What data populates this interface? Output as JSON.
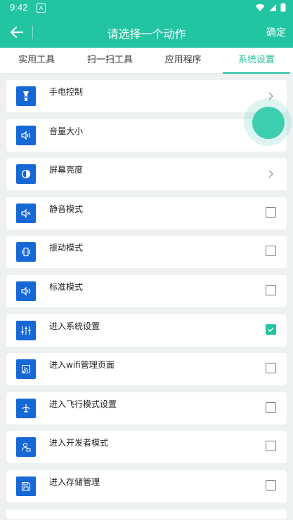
{
  "status_bar": {
    "time": "9:42",
    "notification_glyph": "A"
  },
  "app_bar": {
    "title": "请选择一个动作",
    "confirm_label": "确定"
  },
  "tabs": [
    {
      "label": "实用工具"
    },
    {
      "label": "扫一扫工具"
    },
    {
      "label": "应用程序"
    },
    {
      "label": "系统设置",
      "active": true
    }
  ],
  "items": [
    {
      "label": "手电控制",
      "icon": "flashlight-icon",
      "control": "chevron"
    },
    {
      "label": "音量大小",
      "icon": "volume-icon",
      "control": "chevron"
    },
    {
      "label": "屏幕亮度",
      "icon": "brightness-icon",
      "control": "chevron"
    },
    {
      "label": "静音模式",
      "icon": "mute-icon",
      "control": "checkbox",
      "checked": false
    },
    {
      "label": "振动模式",
      "icon": "vibrate-icon",
      "control": "checkbox",
      "checked": false
    },
    {
      "label": "标准模式",
      "icon": "speaker-icon",
      "control": "checkbox",
      "checked": false
    },
    {
      "label": "进入系统设置",
      "icon": "settings-sliders-icon",
      "control": "checkbox",
      "checked": true
    },
    {
      "label": "进入wifi管理页面",
      "icon": "wifi-icon",
      "control": "checkbox",
      "checked": false
    },
    {
      "label": "进入飞行模式设置",
      "icon": "airplane-icon",
      "control": "checkbox",
      "checked": false
    },
    {
      "label": "进入开发者模式",
      "icon": "developer-icon",
      "control": "checkbox",
      "checked": false
    },
    {
      "label": "进入存储管理",
      "icon": "storage-icon",
      "control": "checkbox",
      "checked": false
    }
  ],
  "colors": {
    "primary": "#22c4a2",
    "icon_bg": "#1568d6",
    "page_bg": "#eef1f1"
  }
}
